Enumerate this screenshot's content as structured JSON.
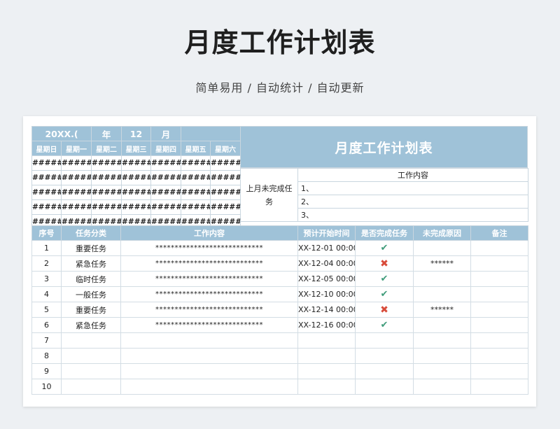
{
  "page": {
    "title": "月度工作计划表",
    "subtitle": "简单易用 / 自动统计 / 自动更新"
  },
  "calendar": {
    "year": "20XX.(",
    "year_suffix": "年",
    "month": "12",
    "month_suffix": "月",
    "weekdays": [
      "星期日",
      "星期一",
      "星期二",
      "星期三",
      "星期四",
      "星期五",
      "星期六"
    ],
    "rows": [
      [
        "#####",
        "#####",
        "#####",
        "#####",
        "#####",
        "#####",
        "#####"
      ],
      [
        "#####",
        "#####",
        "#####",
        "#####",
        "#####",
        "#####",
        "#####"
      ],
      [
        "#####",
        "#####",
        "#####",
        "#####",
        "#####",
        "#####",
        "#####"
      ],
      [
        "#####",
        "#####",
        "#####",
        "#####",
        "#####",
        "#####",
        "#####"
      ],
      [
        "#####",
        "#####",
        "#####",
        "#####",
        "#####",
        "#####",
        "#####"
      ]
    ]
  },
  "banner": {
    "title": "月度工作计划表"
  },
  "last_month": {
    "label": "上月未完成任务",
    "header": "工作内容",
    "items": [
      "1、",
      "2、",
      "3、"
    ]
  },
  "tasks": {
    "headers": [
      "序号",
      "任务分类",
      "工作内容",
      "预计开始时间",
      "是否完成任务",
      "未完成原因",
      "备注"
    ],
    "rows": [
      {
        "no": "1",
        "category": "重要任务",
        "content": "****************************",
        "time": "XX-12-01 00:00",
        "status": "done",
        "reason": "",
        "note": ""
      },
      {
        "no": "2",
        "category": "紧急任务",
        "content": "****************************",
        "time": "XX-12-04 00:00",
        "status": "not_done",
        "reason": "******",
        "note": ""
      },
      {
        "no": "3",
        "category": "临时任务",
        "content": "****************************",
        "time": "XX-12-05 00:00",
        "status": "done",
        "reason": "",
        "note": ""
      },
      {
        "no": "4",
        "category": "一般任务",
        "content": "****************************",
        "time": "XX-12-10 00:00",
        "status": "done",
        "reason": "",
        "note": ""
      },
      {
        "no": "5",
        "category": "重要任务",
        "content": "****************************",
        "time": "XX-12-14 00:00",
        "status": "not_done",
        "reason": "******",
        "note": ""
      },
      {
        "no": "6",
        "category": "紧急任务",
        "content": "****************************",
        "time": "XX-12-16 00:00",
        "status": "done",
        "reason": "",
        "note": ""
      },
      {
        "no": "7",
        "category": "",
        "content": "",
        "time": "",
        "status": "",
        "reason": "",
        "note": ""
      },
      {
        "no": "8",
        "category": "",
        "content": "",
        "time": "",
        "status": "",
        "reason": "",
        "note": ""
      },
      {
        "no": "9",
        "category": "",
        "content": "",
        "time": "",
        "status": "",
        "reason": "",
        "note": ""
      },
      {
        "no": "10",
        "category": "",
        "content": "",
        "time": "",
        "status": "",
        "reason": "",
        "note": ""
      }
    ]
  },
  "icons": {
    "done": "check-icon",
    "not_done": "cross-icon"
  },
  "colors": {
    "header_bg": "#9fc2d8",
    "done": "#3f9c7a",
    "not_done": "#d84b3a",
    "page_bg": "#edf0f3"
  }
}
